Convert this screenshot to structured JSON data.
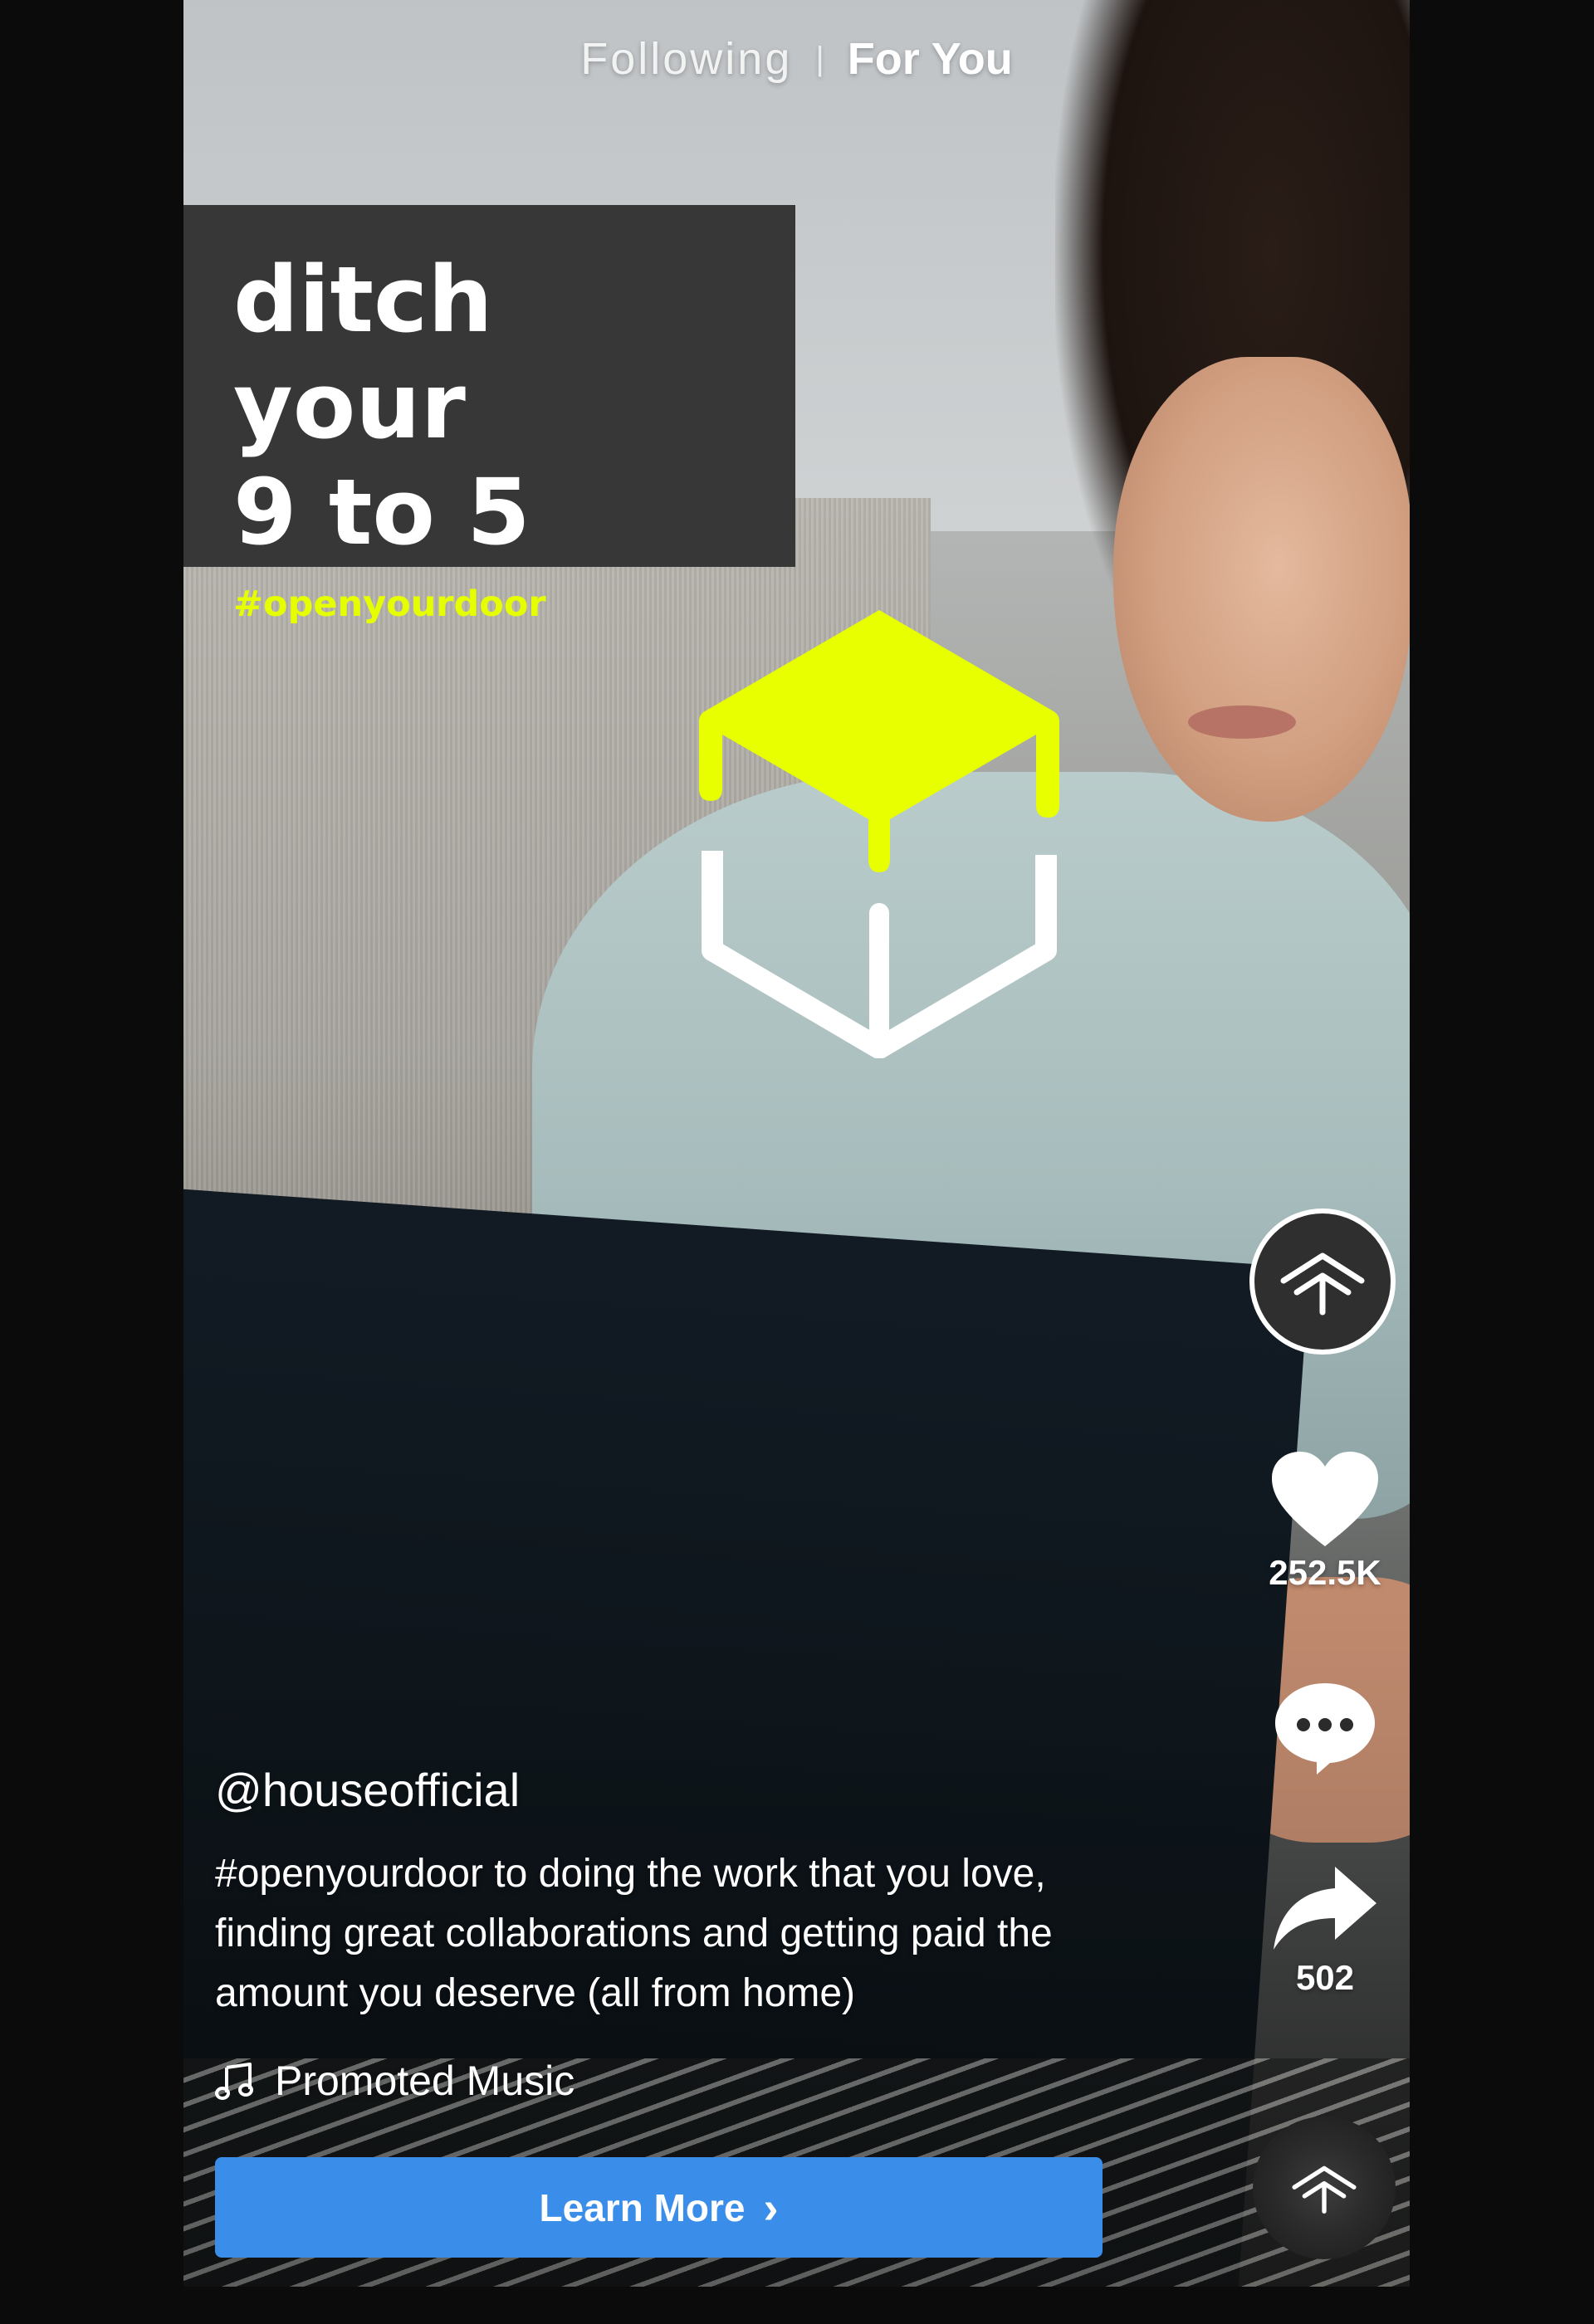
{
  "top_nav": {
    "following_label": "Following",
    "separator": "|",
    "for_you_label": "For You",
    "active_tab": "For You"
  },
  "headline": {
    "line1": "ditch your",
    "line2": "9 to 5",
    "hashtag": "#openyourdoor",
    "hashtag_color": "#e5ff00",
    "card_color": "#373737"
  },
  "brand": {
    "logo_icon": "house-cube-logo",
    "accent_color": "#e5ff00"
  },
  "actions": {
    "profile_icon": "house-logo-avatar",
    "like_icon": "heart-icon",
    "like_count": "252.5K",
    "comment_icon": "comment-icon",
    "share_icon": "share-arrow-icon",
    "share_count": "502"
  },
  "post": {
    "username": "@houseofficial",
    "caption": "#openyourdoor to doing the work that you love,\nfinding great collaborations and getting paid the\namount you deserve (all from home)",
    "music_icon": "music-note-icon",
    "music_label": "Promoted Music"
  },
  "cta": {
    "label": "Learn More",
    "chevron": "›",
    "color": "#3a8eea"
  }
}
